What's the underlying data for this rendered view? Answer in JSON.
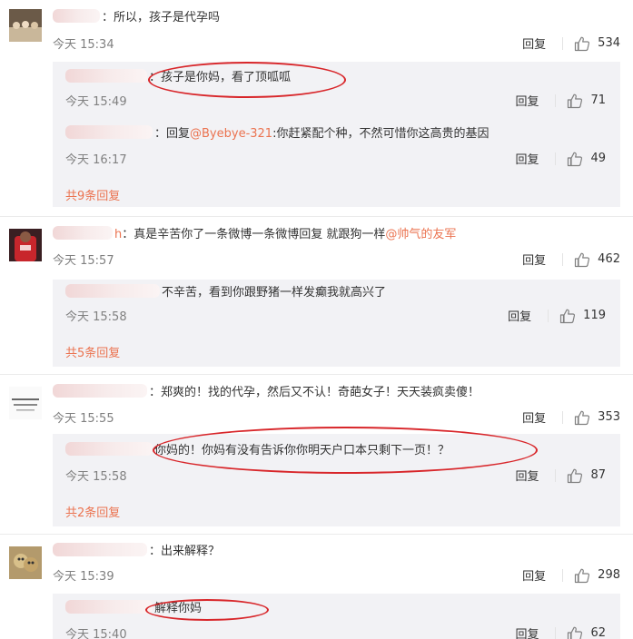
{
  "comments": [
    {
      "text": "：所以，孩子是代孕吗",
      "time": "今天 15:34",
      "reply": "回复",
      "likes": "534",
      "subs": [
        {
          "text": "：孩子是你妈，看了顶呱呱",
          "time": "今天 15:49",
          "reply": "回复",
          "likes": "71"
        },
        {
          "prefix": "：回复",
          "mention": "@Byebye-321",
          "text": ":你赶紧配个种，不然可惜你这高贵的基因",
          "time": "今天 16:17",
          "reply": "回复",
          "likes": "49"
        }
      ],
      "more": "共9条回复"
    },
    {
      "name_tail": "h",
      "text": "：真是辛苦你了一条微博一条微博回复 就跟狗一样",
      "mention": "@帅气的友军",
      "time": "今天 15:57",
      "reply": "回复",
      "likes": "462",
      "subs": [
        {
          "text": "不辛苦，看到你跟野猪一样发癫我就高兴了",
          "time": "今天 15:58",
          "reply": "回复",
          "likes": "119"
        }
      ],
      "more": "共5条回复"
    },
    {
      "text": "：郑爽的！找的代孕，然后又不认！奇葩女子！天天装疯卖傻！",
      "time": "今天 15:55",
      "reply": "回复",
      "likes": "353",
      "subs": [
        {
          "text": "你妈的！你妈有没有告诉你你明天户口本只剩下一页！？",
          "time": "今天 15:58",
          "reply": "回复",
          "likes": "87"
        }
      ],
      "more": "共2条回复"
    },
    {
      "text": "：出来解释？",
      "time": "今天 15:39",
      "reply": "回复",
      "likes": "298",
      "subs": [
        {
          "text": "解释你妈",
          "time": "今天 15:40",
          "reply": "回复",
          "likes": "62"
        }
      ]
    }
  ],
  "colors": {
    "link": "#eb7350",
    "annotation": "#d8262a",
    "sub_bg": "#f2f2f5",
    "time": "#808080"
  },
  "icons": {
    "like": "thumbs-up-icon"
  }
}
